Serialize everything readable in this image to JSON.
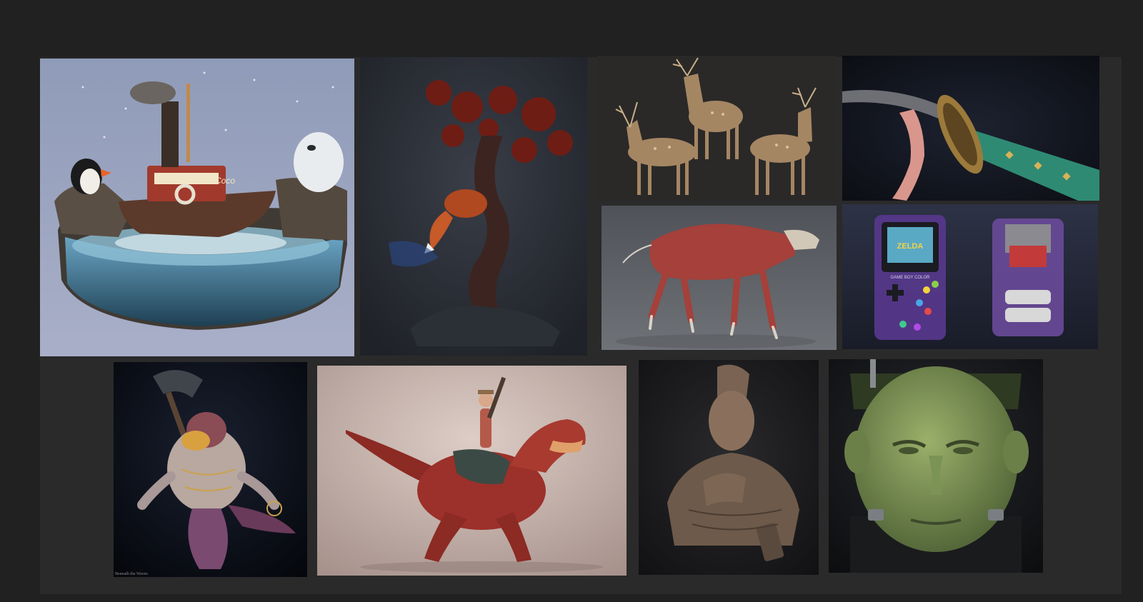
{
  "gallery": {
    "tiles": [
      {
        "id": "tugboat-diorama",
        "icon": "tugboat-diorama-icon"
      },
      {
        "id": "fox-tree",
        "icon": "fox-tree-icon"
      },
      {
        "id": "deer-trio",
        "icon": "deer-icon"
      },
      {
        "id": "katana-hilt",
        "icon": "katana-icon"
      },
      {
        "id": "dog-anatomy",
        "icon": "dog-anatomy-icon"
      },
      {
        "id": "gameboy-color",
        "icon": "gameboy-icon"
      },
      {
        "id": "shark-warrior",
        "icon": "shark-warrior-icon",
        "caption": "Beneath the Waves"
      },
      {
        "id": "dino-rider",
        "icon": "dino-rider-icon"
      },
      {
        "id": "mohawk-bust",
        "icon": "bust-icon"
      },
      {
        "id": "frankenstein",
        "icon": "frankenstein-icon"
      }
    ],
    "gameboy": {
      "screen_title": "ZELDA",
      "brand_label": "GAME BOY COLOR"
    },
    "tugboat": {
      "boat_name": "Coco"
    }
  },
  "colors": {
    "page_background": "#212121",
    "panel_background": "#2a2a2a"
  }
}
